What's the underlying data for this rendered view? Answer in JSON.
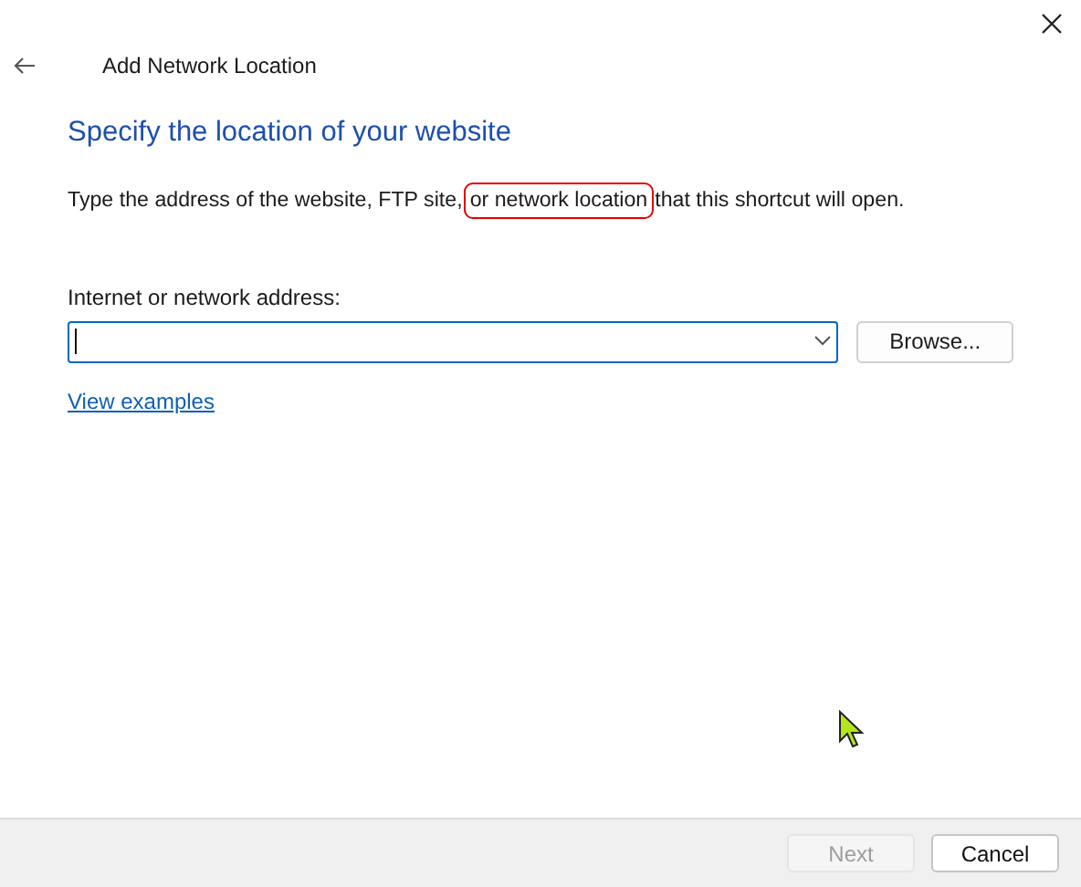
{
  "window": {
    "title": "Add Network Location"
  },
  "heading": "Specify the location of your website",
  "description": {
    "before": "Type the address of the website, FTP site,",
    "highlighted": "or network location",
    "after": "that this shortcut will open."
  },
  "address": {
    "label": "Internet or network address:",
    "focused": true
  },
  "browse_button": "Browse...",
  "examples_link": "View examples",
  "buttons": [
    {
      "label": "Next",
      "disabled": true
    },
    {
      "label": "Cancel",
      "disabled": false
    }
  ]
}
